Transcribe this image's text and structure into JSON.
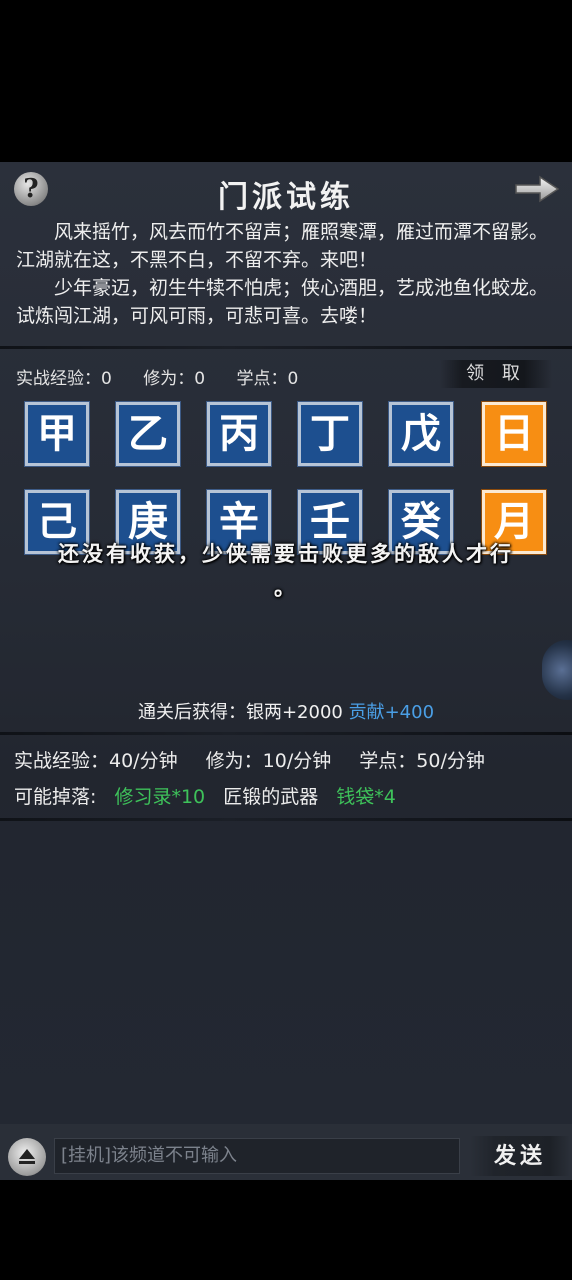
{
  "header": {
    "title": "门派试练",
    "help_symbol": "?"
  },
  "intro": {
    "paragraph1": "风来摇竹，风去而竹不留声；雁照寒潭，雁过而潭不留影。江湖就在这，不黑不白，不留不弃。来吧！",
    "paragraph2": "少年豪迈，初生牛犊不怕虎；侠心酒胆，艺成池鱼化蛟龙。试炼闯江湖，可风可雨，可悲可喜。去喽！"
  },
  "stats": {
    "experience": "实战经验：0",
    "cultivation": "修为：0",
    "points": "学点：0",
    "claim_label": "领 取"
  },
  "tiles_row1": [
    "甲",
    "乙",
    "丙",
    "丁",
    "戊",
    "日"
  ],
  "tiles_row2": [
    "己",
    "庚",
    "辛",
    "壬",
    "癸",
    "月"
  ],
  "overlay": {
    "line1": "还没有收获，少侠需要击败更多的敌人才行",
    "line2": "。"
  },
  "reward": {
    "prefix": "通关后获得：银两+2000 ",
    "highlight": "贡献+400"
  },
  "rates": {
    "experience": "实战经验：40/分钟",
    "cultivation": "修为：10/分钟",
    "points": "学点：50/分钟"
  },
  "drops": {
    "label": "可能掉落:",
    "item1": "修习录*10",
    "item2": "匠锻的武器",
    "item3": "钱袋*4"
  },
  "chat": {
    "placeholder": "[挂机]该频道不可输入",
    "send_label": "发送"
  },
  "colors": {
    "tile_blue": "#1d4f8f",
    "tile_orange": "#f78e13",
    "link_blue": "#4a9fe6",
    "drop_green": "#3ec25a"
  },
  "icons": [
    "help-icon",
    "arrow-right-icon",
    "eject-up-icon"
  ]
}
